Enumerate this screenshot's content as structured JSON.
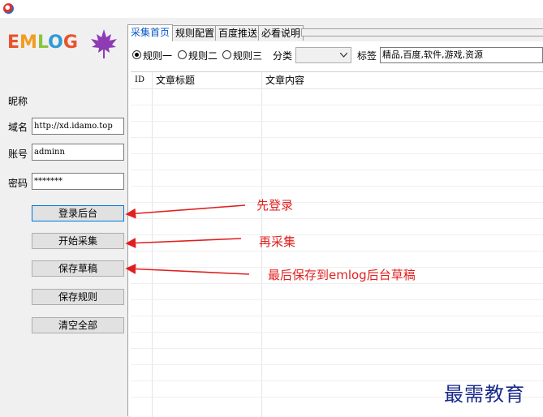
{
  "logo": {
    "e": "E",
    "m": "M",
    "l": "L",
    "o": "O",
    "g": "G"
  },
  "left": {
    "nickname_label": "昵称",
    "domain_label": "域名",
    "domain_value": "http://xd.idamo.top",
    "account_label": "账号",
    "account_value": "adminn",
    "password_label": "密码",
    "password_value": "*******",
    "buttons": [
      "登录后台",
      "开始采集",
      "保存草稿",
      "保存规则",
      "清空全部"
    ]
  },
  "tabs": [
    "采集首页",
    "规则配置",
    "百度推送",
    "必看说明"
  ],
  "options": {
    "rules": [
      "规则一",
      "规则二",
      "规则三"
    ],
    "category_label": "分类",
    "category_value": "",
    "tags_label": "标签",
    "tags_value": "精品,百度,软件,游戏,资源"
  },
  "grid": {
    "headers": [
      "ID",
      "文章标题",
      "文章内容"
    ]
  },
  "annotations": [
    "先登录",
    "再采集",
    "最后保存到emlog后台草稿"
  ],
  "watermark": "最需教育",
  "colors": {
    "accent": "#0078d7",
    "annotation": "#e02020",
    "tab_active": "#0a58c9"
  }
}
